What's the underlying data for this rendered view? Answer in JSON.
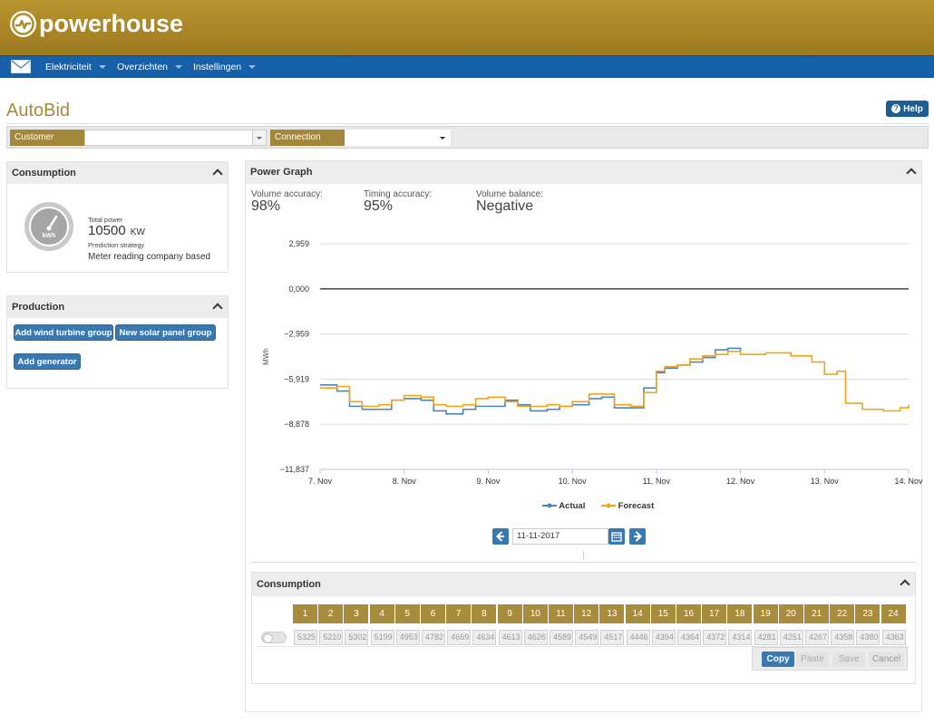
{
  "app": {
    "brand": "powerhouse"
  },
  "nav": {
    "items": [
      {
        "label": "Elektriciteit"
      },
      {
        "label": "Overzichten"
      },
      {
        "label": "Instellingen"
      }
    ]
  },
  "page": {
    "title": "AutoBid",
    "help_label": "Help"
  },
  "filters": {
    "customer_label": "Customer",
    "customer_value": "",
    "connection_label": "Connection",
    "connection_value": ""
  },
  "consumption_panel": {
    "title": "Consumption",
    "meter_icon_text": "kWh",
    "total_power_label": "Total power",
    "total_power_value": "10500",
    "total_power_unit": "KW",
    "strategy_label": "Prediction strategy",
    "strategy_value": "Meter reading company based"
  },
  "production_panel": {
    "title": "Production",
    "buttons": [
      "Add wind turbine group",
      "New solar panel group",
      "Add generator"
    ]
  },
  "power_graph": {
    "title": "Power Graph",
    "metrics": [
      {
        "label": "Volume accuracy:",
        "value": "98%"
      },
      {
        "label": "Timing accuracy:",
        "value": "95%"
      },
      {
        "label": "Volume balance:",
        "value": "Negative"
      }
    ],
    "date_value": "11-11-2017"
  },
  "chart_data": {
    "type": "line",
    "title": "",
    "xlabel": "",
    "ylabel": "MWh",
    "y_ticks": [
      "2,959",
      "0,000",
      "−2,959",
      "−5,919",
      "−8,878",
      "−11,837"
    ],
    "y_tick_values": [
      2.959,
      0,
      -2.959,
      -5.919,
      -8.878,
      -11.837
    ],
    "x_ticks": [
      "7. Nov",
      "8. Nov",
      "9. Nov",
      "10. Nov",
      "11. Nov",
      "12. Nov",
      "13. Nov",
      "14. Nov"
    ],
    "ylim": [
      -11.837,
      2.959
    ],
    "xlim": [
      0,
      7
    ],
    "grid": true,
    "legend_position": "bottom-center",
    "series": [
      {
        "name": "Actual",
        "color": "#4a87bf",
        "x": [
          0,
          0.2,
          0.35,
          0.5,
          0.7,
          0.85,
          1.0,
          1.2,
          1.35,
          1.5,
          1.7,
          1.85,
          2.0,
          2.2,
          2.35,
          2.5,
          2.7,
          2.85,
          3.0,
          3.2,
          3.35,
          3.5,
          3.7,
          3.85,
          4.0,
          4.1,
          4.25,
          4.4,
          4.55,
          4.7,
          4.85,
          5.0
        ],
        "values": [
          -6.3,
          -6.7,
          -7.7,
          -7.9,
          -7.9,
          -7.3,
          -7.2,
          -7.3,
          -8.0,
          -8.2,
          -7.9,
          -7.7,
          -7.7,
          -7.3,
          -7.6,
          -8.0,
          -7.9,
          -7.7,
          -7.6,
          -7.2,
          -7.1,
          -7.8,
          -7.8,
          -6.5,
          -5.5,
          -5.2,
          -5.0,
          -4.8,
          -4.5,
          -4.0,
          -3.9,
          -4.1
        ]
      },
      {
        "name": "Forecast",
        "color": "#f7a21b",
        "x": [
          0,
          0.2,
          0.35,
          0.5,
          0.7,
          0.85,
          1.0,
          1.2,
          1.35,
          1.5,
          1.7,
          1.85,
          2.0,
          2.2,
          2.35,
          2.5,
          2.7,
          2.85,
          3.0,
          3.2,
          3.35,
          3.5,
          3.7,
          3.85,
          4.0,
          4.1,
          4.25,
          4.4,
          4.55,
          4.7,
          4.85,
          5.0,
          5.3,
          5.6,
          5.85,
          6.0,
          6.15,
          6.25,
          6.45,
          6.7,
          6.9,
          7.0
        ],
        "values": [
          -6.5,
          -6.4,
          -7.4,
          -7.7,
          -7.6,
          -7.3,
          -7.0,
          -7.1,
          -7.6,
          -7.7,
          -7.6,
          -7.2,
          -7.1,
          -7.4,
          -7.7,
          -7.7,
          -7.6,
          -7.7,
          -7.4,
          -6.9,
          -6.9,
          -7.6,
          -7.7,
          -6.8,
          -5.4,
          -5.1,
          -5.0,
          -4.6,
          -4.4,
          -4.3,
          -4.1,
          -4.3,
          -4.2,
          -4.4,
          -4.8,
          -5.6,
          -5.4,
          -7.5,
          -7.9,
          -8.0,
          -7.8,
          -7.6
        ]
      }
    ]
  },
  "hourly": {
    "title": "Consumption",
    "hours": [
      "1",
      "2",
      "3",
      "4",
      "5",
      "6",
      "7",
      "8",
      "9",
      "10",
      "11",
      "12",
      "13",
      "14",
      "15",
      "16",
      "17",
      "18",
      "19",
      "20",
      "21",
      "22",
      "23",
      "24"
    ],
    "values": [
      "5325",
      "5210",
      "5302",
      "5199",
      "4953",
      "4782",
      "4669",
      "4634",
      "4613",
      "4626",
      "4589",
      "4549",
      "4517",
      "4446",
      "4394",
      "4364",
      "4372",
      "4314",
      "4281",
      "4251",
      "4267",
      "4358",
      "4380",
      "4363"
    ],
    "actions": [
      "Copy",
      "Paste",
      "Save",
      "Cancel"
    ]
  }
}
